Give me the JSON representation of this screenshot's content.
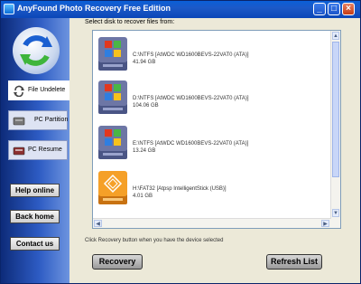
{
  "window": {
    "title": "AnyFound Photo Recovery Free Edition",
    "minimize": "_",
    "maximize": "□",
    "close": "×"
  },
  "sidebar": {
    "tabs": [
      {
        "label": "File Undelete",
        "icon": "rotate-icon"
      },
      {
        "label": "PC Partition",
        "icon": "harddisk-icon"
      },
      {
        "label": "PC Resume",
        "icon": "disk-icon"
      }
    ],
    "buttons": {
      "help": "Help online",
      "back": "Back home",
      "contact": "Contact us"
    }
  },
  "main": {
    "select_label": "Select disk to recover files from:",
    "disks": [
      {
        "line1": "C:\\NTFS [AtWDC WD1600BEVS-22VAT0  (ATA)]",
        "line2": "41.94 GB",
        "icon": "windows-disk-icon"
      },
      {
        "line1": "D:\\NTFS [AtWDC WD1600BEVS-22VAT0  (ATA)]",
        "line2": "104.06 GB",
        "icon": "windows-disk-icon"
      },
      {
        "line1": "E:\\NTFS [AtWDC WD1600BEVS-22VAT0  (ATA)]",
        "line2": "13.24 GB",
        "icon": "windows-disk-icon"
      },
      {
        "line1": "H:\\FAT32 [Atpsp   IntelligentStick  (USB)]",
        "line2": "4.01 GB",
        "icon": "usb-disk-icon"
      }
    ],
    "hint": "Click Recovery button when you have the device selected",
    "recovery_label": "Recovery",
    "refresh_label": "Refresh List"
  },
  "colors": {
    "title_bar": "#0b47b8",
    "sidebar": "#2d5bc3",
    "windows_disk": "#6d76a5",
    "usb_disk": "#f5a028"
  }
}
